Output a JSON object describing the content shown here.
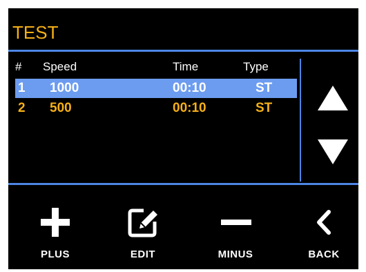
{
  "title": "TEST",
  "colors": {
    "accent": "#f5b017",
    "divider": "#4d86e6",
    "selection": "#6c9cf0",
    "background": "#000000"
  },
  "table": {
    "headers": [
      "#",
      "Speed",
      "Time",
      "Type"
    ],
    "rows": [
      {
        "index": "1",
        "speed": "1000",
        "time": "00:10",
        "type": "ST",
        "selected": true
      },
      {
        "index": "2",
        "speed": "500",
        "time": "00:10",
        "type": "ST",
        "selected": false
      }
    ]
  },
  "scroll": {
    "up_icon": "triangle-up-icon",
    "down_icon": "triangle-down-icon"
  },
  "footer": {
    "plus": {
      "label": "PLUS",
      "icon": "plus-icon"
    },
    "edit": {
      "label": "EDIT",
      "icon": "edit-icon"
    },
    "minus": {
      "label": "MINUS",
      "icon": "minus-icon"
    },
    "back": {
      "label": "BACK",
      "icon": "chevron-left-icon"
    }
  }
}
